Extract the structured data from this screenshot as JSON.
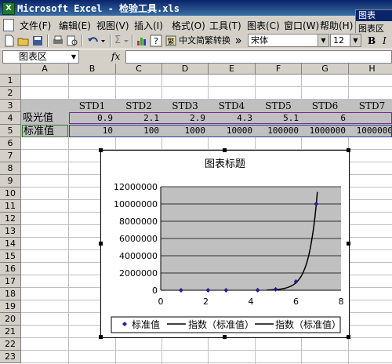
{
  "window": {
    "title": "Microsoft Excel - 检验工具.xls",
    "app_icon": "excel-icon"
  },
  "menu": [
    "文件(F)",
    "编辑(E)",
    "视图(V)",
    "插入(I)",
    "格式(O)",
    "工具(T)",
    "图表(C)",
    "窗口(W)",
    "帮助(H)"
  ],
  "chart_popup": {
    "title": "图表",
    "item": "图表区"
  },
  "toolbar": {
    "sigma": "Σ",
    "conversion": "中文简繁转换",
    "font": "宋体",
    "font_size": "12",
    "bold": "B",
    "italic": "I"
  },
  "formula_bar": {
    "name_box": "图表区",
    "fx": "fx",
    "content": ""
  },
  "columns": [
    "A",
    "B",
    "C",
    "D",
    "E",
    "F",
    "G",
    "H"
  ],
  "rows": [
    "1",
    "2",
    "3",
    "4",
    "5",
    "6",
    "7",
    "8",
    "9",
    "10",
    "11",
    "12",
    "13",
    "14",
    "15",
    "16",
    "17",
    "18",
    "19",
    "20",
    "21",
    "22",
    "23"
  ],
  "sheet": {
    "header_row": [
      "STD1",
      "STD2",
      "STD3",
      "STD4",
      "STD5",
      "STD6",
      "STD7"
    ],
    "row4": {
      "label": "吸光值",
      "values": [
        "0.9",
        "2.1",
        "2.9",
        "4.3",
        "5.1",
        "6",
        ""
      ]
    },
    "row5": {
      "label": "标准值",
      "values": [
        "10",
        "100",
        "1000",
        "10000",
        "100000",
        "1000000",
        "1000000"
      ]
    }
  },
  "chart_data": {
    "type": "scatter",
    "title": "图表标题",
    "xlim": [
      0,
      8
    ],
    "ylim": [
      0,
      12000000
    ],
    "x_ticks": [
      "0",
      "2",
      "4",
      "6",
      "8"
    ],
    "y_ticks": [
      "0",
      "2000000",
      "4000000",
      "6000000",
      "8000000",
      "10000000",
      "12000000"
    ],
    "grid": true,
    "legend_position": "bottom",
    "series": [
      {
        "name": "标准值",
        "kind": "points",
        "x": [
          0.9,
          2.1,
          2.9,
          4.3,
          5.1,
          6,
          6.9
        ],
        "y": [
          10,
          100,
          1000,
          10000,
          100000,
          1000000,
          10000000
        ],
        "color": "#1f1f8f"
      },
      {
        "name": "指数（标准值）",
        "kind": "exp-trendline",
        "a": 0.0785,
        "b": 2.704,
        "x_range": [
          4.7,
          6.95
        ],
        "color": "#000000"
      },
      {
        "name": "指数（标准值）",
        "kind": "exp-trendline",
        "a": 0.0785,
        "b": 2.704,
        "x_range": [
          4.7,
          6.95
        ],
        "color": "#000000"
      }
    ],
    "plot_bg": "#c0c0c0"
  }
}
